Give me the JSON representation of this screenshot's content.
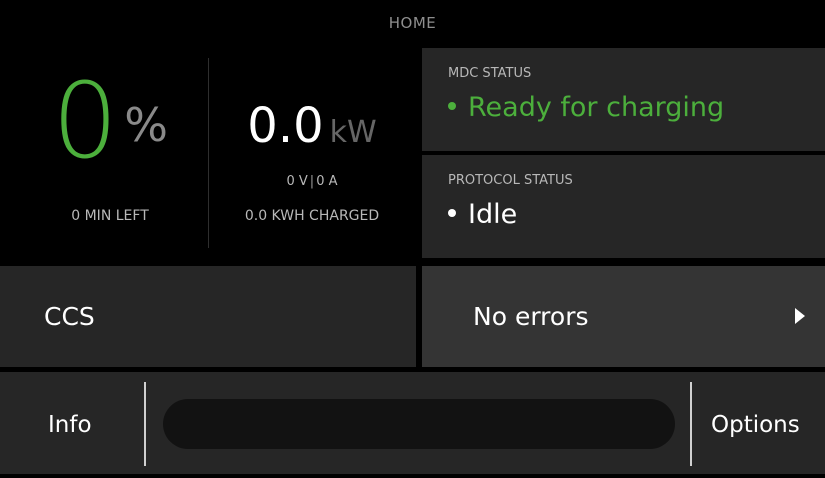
{
  "header": {
    "title": "HOME"
  },
  "gauge": {
    "soc": {
      "value": "0",
      "unit": "%",
      "time_left": "0 MIN LEFT"
    },
    "power": {
      "value": "0.0",
      "unit": "kW",
      "voltage": "0 V",
      "separator": "|",
      "current": "0 A",
      "energy_charged": "0.0 KWH CHARGED"
    }
  },
  "mdc_status": {
    "label": "MDC STATUS",
    "value": "Ready for charging",
    "color": "#4caf3c"
  },
  "protocol_status": {
    "label": "PROTOCOL STATUS",
    "value": "Idle"
  },
  "connector": {
    "label": "CCS"
  },
  "errors": {
    "label": "No errors",
    "icon": "caret-right-icon"
  },
  "bottom_bar": {
    "info_label": "Info",
    "options_label": "Options",
    "progress": {
      "fraction": 0
    }
  }
}
